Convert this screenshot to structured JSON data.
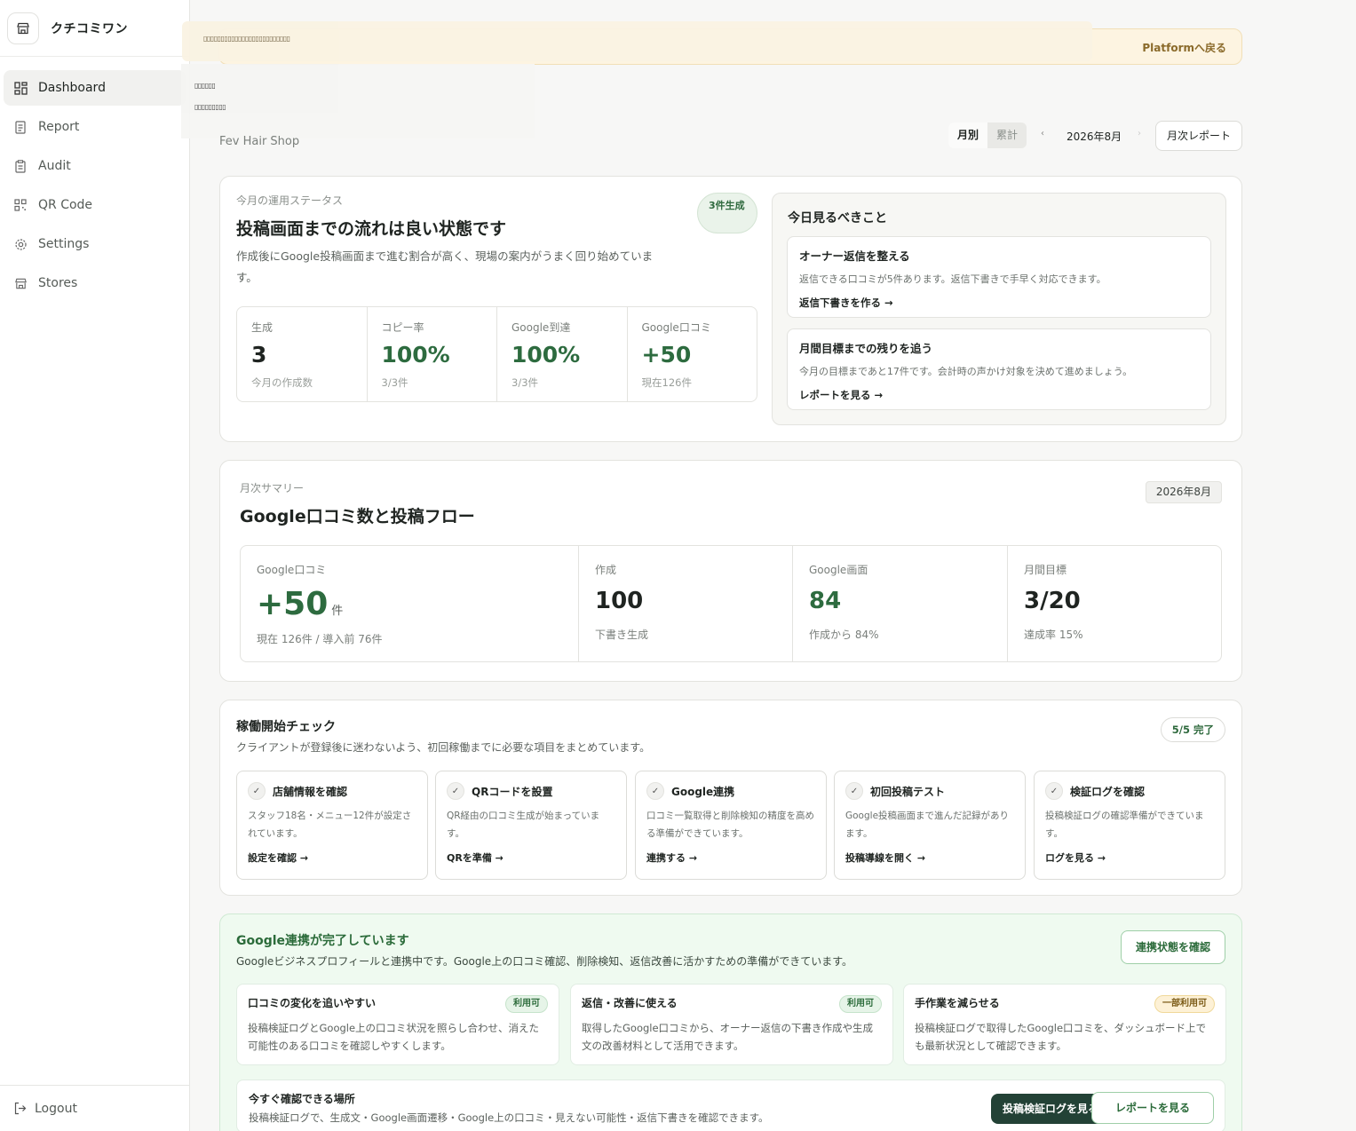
{
  "app": {
    "name": "クチコミワン"
  },
  "sidebar": {
    "items": [
      {
        "label": "Dashboard",
        "icon": "dashboard-icon"
      },
      {
        "label": "Report",
        "icon": "document-icon"
      },
      {
        "label": "Audit",
        "icon": "clipboard-icon"
      },
      {
        "label": "QR Code",
        "icon": "qr-code-icon"
      },
      {
        "label": "Settings",
        "icon": "gear-icon"
      },
      {
        "label": "Stores",
        "icon": "store-icon"
      }
    ],
    "logout": "Logout"
  },
  "banner": {
    "link": "Platformへ戻る"
  },
  "overlay": {
    "line1": "▯▯▯▯▯▯▯▯▯▯▯▯▯▯▯▯▯▯▯▯▯▯▯▯▯",
    "line2": "▯▯▯▯▯▯",
    "line3": "▯▯▯▯▯▯▯▯▯"
  },
  "header": {
    "store_name": "Fev Hair Shop",
    "view_monthly": "月別",
    "view_cumulative": "累計",
    "prev": "‹",
    "month": "2026年8月",
    "next": "›",
    "report_button": "月次レポート"
  },
  "status": {
    "eyebrow": "今月の運用ステータス",
    "title": "投稿画面までの流れは良い状態です",
    "description": "作成後にGoogle投稿画面まで進む割合が高く、現場の案内がうまく回り始めています。",
    "badge": "3件生成",
    "metrics": [
      {
        "label": "生成",
        "value": "3",
        "sub": "今月の作成数"
      },
      {
        "label": "コピー率",
        "value": "100%",
        "sub": "3/3件"
      },
      {
        "label": "Google到達",
        "value": "100%",
        "sub": "3/3件"
      },
      {
        "label": "Google口コミ",
        "value": "+50",
        "sub": "現在126件"
      }
    ]
  },
  "todo": {
    "title": "今日見るべきこと",
    "items": [
      {
        "title": "オーナー返信を整える",
        "desc": "返信できる口コミが5件あります。返信下書きで手早く対応できます。",
        "link": "返信下書きを作る →"
      },
      {
        "title": "月間目標までの残りを追う",
        "desc": "今月の目標まであと17件です。会計時の声かけ対象を決めて進めましょう。",
        "link": "レポートを見る →"
      }
    ]
  },
  "summary": {
    "eyebrow": "月次サマリー",
    "title": "Google口コミ数と投稿フロー",
    "month": "2026年8月",
    "google": {
      "label": "Google口コミ",
      "value": "+50",
      "unit": "件",
      "sub": "現在 126件 / 導入前 76件"
    },
    "cells": [
      {
        "label": "作成",
        "value": "100",
        "sub": "下書き生成"
      },
      {
        "label": "Google画面",
        "value": "84",
        "sub": "作成から 84%"
      },
      {
        "label": "月間目標",
        "value": "3/20",
        "sub": "達成率 15%"
      }
    ]
  },
  "check": {
    "title": "稼働開始チェック",
    "desc": "クライアントが登録後に迷わないよう、初回稼働までに必要な項目をまとめています。",
    "badge": "5/5 完了",
    "check_mark": "✓",
    "items": [
      {
        "name": "店舗情報を確認",
        "text": "スタッフ18名・メニュー12件が設定されています。",
        "link": "設定を確認 →"
      },
      {
        "name": "QRコードを設置",
        "text": "QR経由の口コミ生成が始まっています。",
        "link": "QRを準備 →"
      },
      {
        "name": "Google連携",
        "text": "口コミ一覧取得と削除検知の精度を高める準備ができています。",
        "link": "連携する →"
      },
      {
        "name": "初回投稿テスト",
        "text": "Google投稿画面まで進んだ記録があります。",
        "link": "投稿導線を開く →"
      },
      {
        "name": "検証ログを確認",
        "text": "投稿検証ログの確認準備ができています。",
        "link": "ログを見る →"
      }
    ]
  },
  "google": {
    "title": "Google連携が完了しています",
    "desc": "Googleビジネスプロフィールと連携中です。Google上の口コミ確認、削除検知、返信改善に活かすための準備ができています。",
    "button": "連携状態を確認",
    "items": [
      {
        "title": "口コミの変化を追いやすい",
        "tag": "利用可",
        "desc": "投稿検証ログとGoogle上の口コミ状況を照らし合わせ、消えた可能性のある口コミを確認しやすくします。"
      },
      {
        "title": "返信・改善に使える",
        "tag": "利用可",
        "desc": "取得したGoogle口コミから、オーナー返信の下書き作成や生成文の改善材料として活用できます。"
      },
      {
        "title": "手作業を減らせる",
        "tag": "一部利用可",
        "desc": "投稿検証ログで取得したGoogle口コミを、ダッシュボード上でも最新状況として確認できます。"
      }
    ],
    "bottom": {
      "title": "今すぐ確認できる場所",
      "desc": "投稿検証ログで、生成文・Google画面遷移・Google上の口コミ・見えない可能性・返信下書きを確認できます。",
      "primary": "投稿検証ログを見る",
      "secondary": "レポートを見る"
    }
  }
}
